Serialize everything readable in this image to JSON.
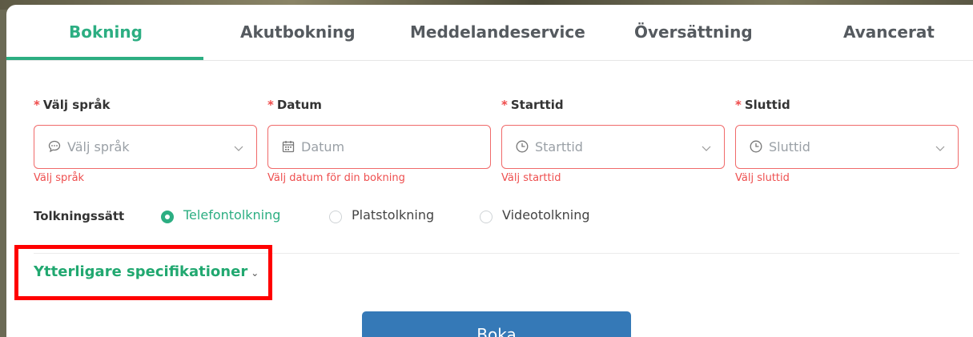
{
  "tabs": [
    {
      "label": "Bokning",
      "active": true
    },
    {
      "label": "Akutbokning",
      "active": false
    },
    {
      "label": "Meddelandeservice",
      "active": false
    },
    {
      "label": "Översättning",
      "active": false
    },
    {
      "label": "Avancerat",
      "active": false
    }
  ],
  "fields": [
    {
      "label": "Välj språk",
      "required_mark": "*",
      "placeholder": "Välj språk",
      "icon": "chat-bubble-icon",
      "has_dropdown": true,
      "error": "Välj språk"
    },
    {
      "label": "Datum",
      "required_mark": "*",
      "placeholder": "Datum",
      "icon": "calendar-icon",
      "has_dropdown": false,
      "error": "Välj datum för din bokning"
    },
    {
      "label": "Starttid",
      "required_mark": "*",
      "placeholder": "Starttid",
      "icon": "clock-icon",
      "has_dropdown": true,
      "error": "Välj starttid"
    },
    {
      "label": "Sluttid",
      "required_mark": "*",
      "placeholder": "Sluttid",
      "icon": "clock-icon",
      "has_dropdown": true,
      "error": "Välj sluttid"
    }
  ],
  "interpretation": {
    "label": "Tolkningssätt",
    "options": [
      {
        "label": "Telefontolkning",
        "selected": true
      },
      {
        "label": "Platstolkning",
        "selected": false
      },
      {
        "label": "Videotolkning",
        "selected": false
      }
    ]
  },
  "more_specs": {
    "label": "Ytterligare specifikationer",
    "chevron": "⌄"
  },
  "submit": {
    "label": "Boka"
  },
  "colors": {
    "accent": "#2cae82",
    "error": "#ee4f4f",
    "button": "#3579b7",
    "highlight": "#ff0000"
  }
}
